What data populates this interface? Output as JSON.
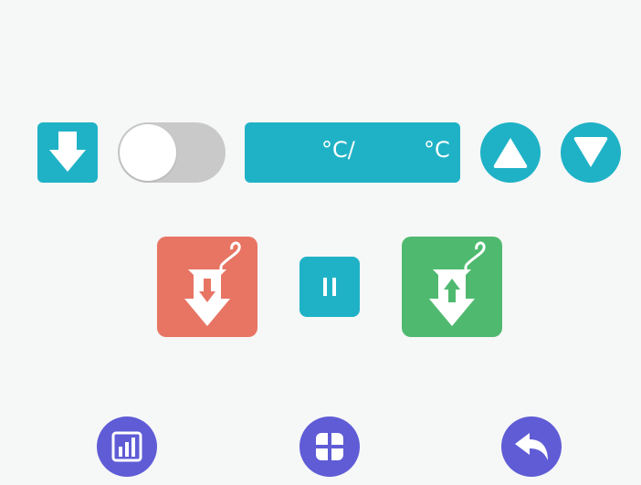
{
  "nozzle_icon": "nozzle-down-icon",
  "toggle": {
    "state": "off"
  },
  "temperature": {
    "current": "",
    "current_unit": "°C/",
    "target": "",
    "target_unit": "°C"
  },
  "buttons": {
    "increase": "triangle-up-icon",
    "decrease": "triangle-down-icon",
    "load": "filament-load-icon",
    "pause": "pause-icon",
    "unload": "filament-unload-icon"
  },
  "nav": {
    "stats": "bar-chart-icon",
    "menu": "grid-icon",
    "back": "back-arrow-icon"
  },
  "colors": {
    "accent": "#1fb2c6",
    "load": "#e87564",
    "unload": "#4fba6f",
    "nav": "#5f5cd6",
    "toggle_off": "#c9c9c9",
    "background": "#f6f7f7"
  }
}
